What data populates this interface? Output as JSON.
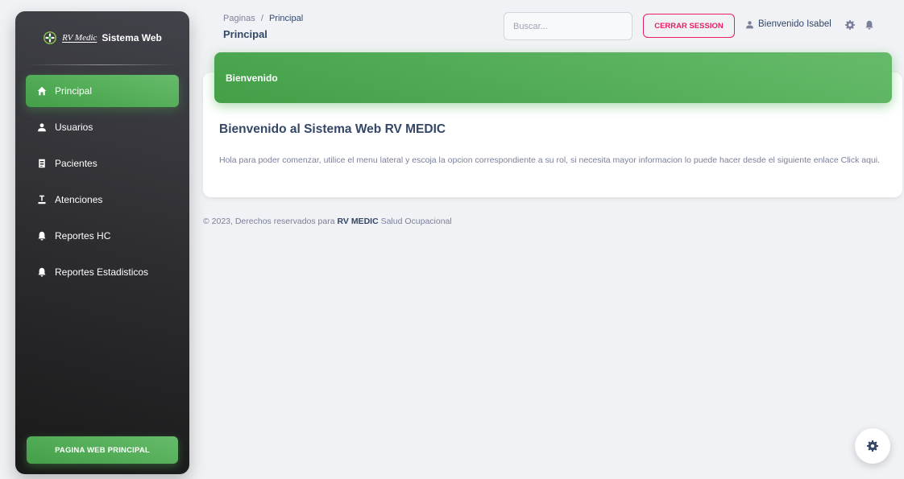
{
  "sidebar": {
    "brand": {
      "script": "RV Medic",
      "name": "Sistema Web"
    },
    "items": [
      {
        "label": "Principal",
        "icon": "home-icon",
        "active": true
      },
      {
        "label": "Usuarios",
        "icon": "user-icon",
        "active": false
      },
      {
        "label": "Pacientes",
        "icon": "clipboard-icon",
        "active": false
      },
      {
        "label": "Atenciones",
        "icon": "pen-icon",
        "active": false
      },
      {
        "label": "Reportes HC",
        "icon": "bell-icon",
        "active": false
      },
      {
        "label": "Reportes Estadisticos",
        "icon": "bell-icon",
        "active": false
      }
    ],
    "bottom_button": "PAGINA WEB PRINCIPAL"
  },
  "header": {
    "breadcrumb_root": "Paginas",
    "breadcrumb_sep": "/",
    "breadcrumb_current": "Principal",
    "title": "Principal",
    "search_placeholder": "Buscar...",
    "logout_label": "CERRAR SESSION",
    "user_label": "Bienvenido Isabel"
  },
  "card": {
    "header": "Bienvenido",
    "title": "Bienvenido al Sistema Web RV MEDIC",
    "text": "Hola para poder comenzar, utilice el menu lateral y escoja la opcion correspondiente a su rol, si necesita mayor informacion lo puede hacer desde el siguiente enlace Click aqui."
  },
  "footer": {
    "prefix": "© 2023, Derechos reservados para ",
    "brand": "RV MEDIC",
    "suffix": " Salud Ocupacional"
  },
  "colors": {
    "accent_green": "#4caf50",
    "logout_pink": "#e91e63",
    "sidebar_dark": "#191919"
  }
}
